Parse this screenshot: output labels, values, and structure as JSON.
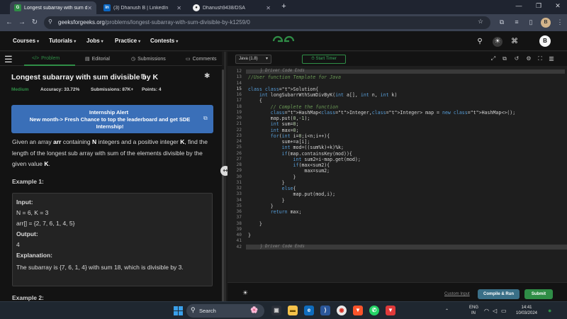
{
  "browser": {
    "tabs": [
      {
        "label": "Longest subarray with sum divisible by K",
        "icon": "gfg-favicon",
        "color": "#2f8d46",
        "favtext": "G"
      },
      {
        "label": "(3) Dhanush B | LinkedIn",
        "icon": "linkedin-favicon",
        "color": "#0a66c2",
        "favtext": "in"
      },
      {
        "label": "Dhanush9438/DSA",
        "icon": "github-favicon",
        "color": "#24292f",
        "favtext": "◉"
      }
    ],
    "url_host": "geeksforgeeks.org",
    "url_path": "/problems/longest-subarray-with-sum-divisible-by-k1259/0",
    "new_tab": "+",
    "profile_initial": "B"
  },
  "nav": {
    "menus": [
      "Courses",
      "Tutorials",
      "Jobs",
      "Practice",
      "Contests"
    ],
    "user_initial": "B"
  },
  "left": {
    "subtabs": [
      "Problem",
      "Editorial",
      "Submissions",
      "Comments"
    ],
    "title": "Longest subarray with sum divisible by K",
    "meta": {
      "difficulty": "Medium",
      "accuracy": "Accuracy: 33.72%",
      "submissions": "Submissions: 87K+",
      "points": "Points: 4"
    },
    "alert": {
      "title": "Internship Alert",
      "body": "New month-> Fresh Chance to top the leaderboard and get SDE Internship!"
    },
    "desc": {
      "p1": "Given an array ",
      "arr": "arr",
      "p2": " containing ",
      "N": "N",
      "p3": " integers and a positive integer ",
      "K": "K",
      "p4": ", find the length of the longest sub array with sum of the elements divisible by the given value ",
      "K2": "K",
      "p5": "."
    },
    "example1": {
      "heading": "Example 1:",
      "input_label": "Input:",
      "input_line1": "N = 6, K = 3",
      "input_line2": "arr[] = {2, 7, 6, 1, 4, 5}",
      "output_label": "Output:",
      "output_value": "4",
      "explanation_label": "Explanation:",
      "explanation": "The subarray is {7, 6, 1, 4} with sum 18, which is divisible by 3."
    },
    "example2_heading": "Example 2:"
  },
  "editor": {
    "language": "Java (1.8)",
    "timer": "Start Timer",
    "line_numbers": [
      "12",
      "13",
      "14",
      "15",
      "16",
      "17",
      "18",
      "19",
      "20",
      "21",
      "22",
      "23",
      "24",
      "25",
      "26",
      "27",
      "28",
      "29",
      "30",
      "31",
      "32",
      "33",
      "34",
      "35",
      "36",
      "37",
      "38",
      "39",
      "40",
      "41",
      "42"
    ],
    "fold_top": "} Driver Code Ends",
    "fold_bottom": "} Driver Code Ends",
    "lines": [
      "",
      "//User function Template for Java",
      "",
      "class Solution{",
      "    int longSubarrWthSumDivByK(int a[], int n, int k)",
      "    {",
      "        // Complete the function",
      "        HashMap<Integer,Integer> map = new HashMap<>();",
      "        map.put(0,-1);",
      "        int sum=0;",
      "        int max=0;",
      "        for(int i=0;i<n;i++){",
      "            sum+=a[i];",
      "            int mod=((sum%k)+k)%k;",
      "            if(map.containsKey(mod)){",
      "                int sum2=i-map.get(mod);",
      "                if(max<sum2){",
      "                    max=sum2;",
      "                }",
      "            }",
      "            else{",
      "                map.put(mod,i);",
      "            }",
      "        }",
      "        return max;",
      "    ",
      "    }",
      "    ",
      "}",
      "",
      ""
    ],
    "custom_input": "Custom Input",
    "compile": "Compile & Run",
    "submit": "Submit"
  },
  "taskbar": {
    "search": "Search",
    "lang": "ENG",
    "region": "IN",
    "time": "14:41",
    "date": "10/03/2024"
  }
}
